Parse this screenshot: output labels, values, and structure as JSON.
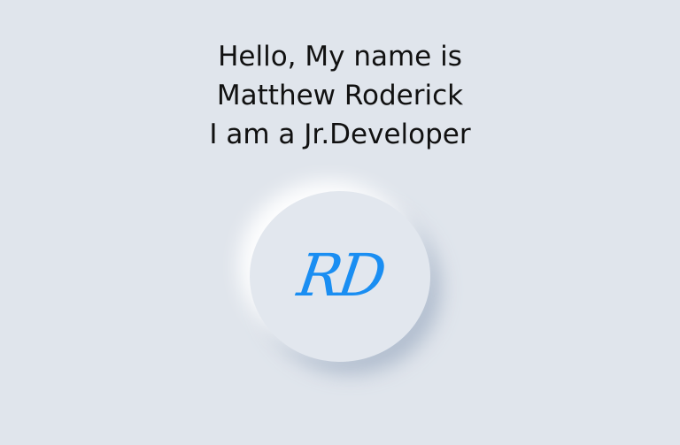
{
  "intro": {
    "line1": "Hello, My name is",
    "line2": "Matthew Roderick",
    "line3": "I am a Jr.Developer"
  },
  "logo": {
    "initials": "RD",
    "color": "#1a8ef2"
  },
  "colors": {
    "background": "#e0e5ec"
  }
}
